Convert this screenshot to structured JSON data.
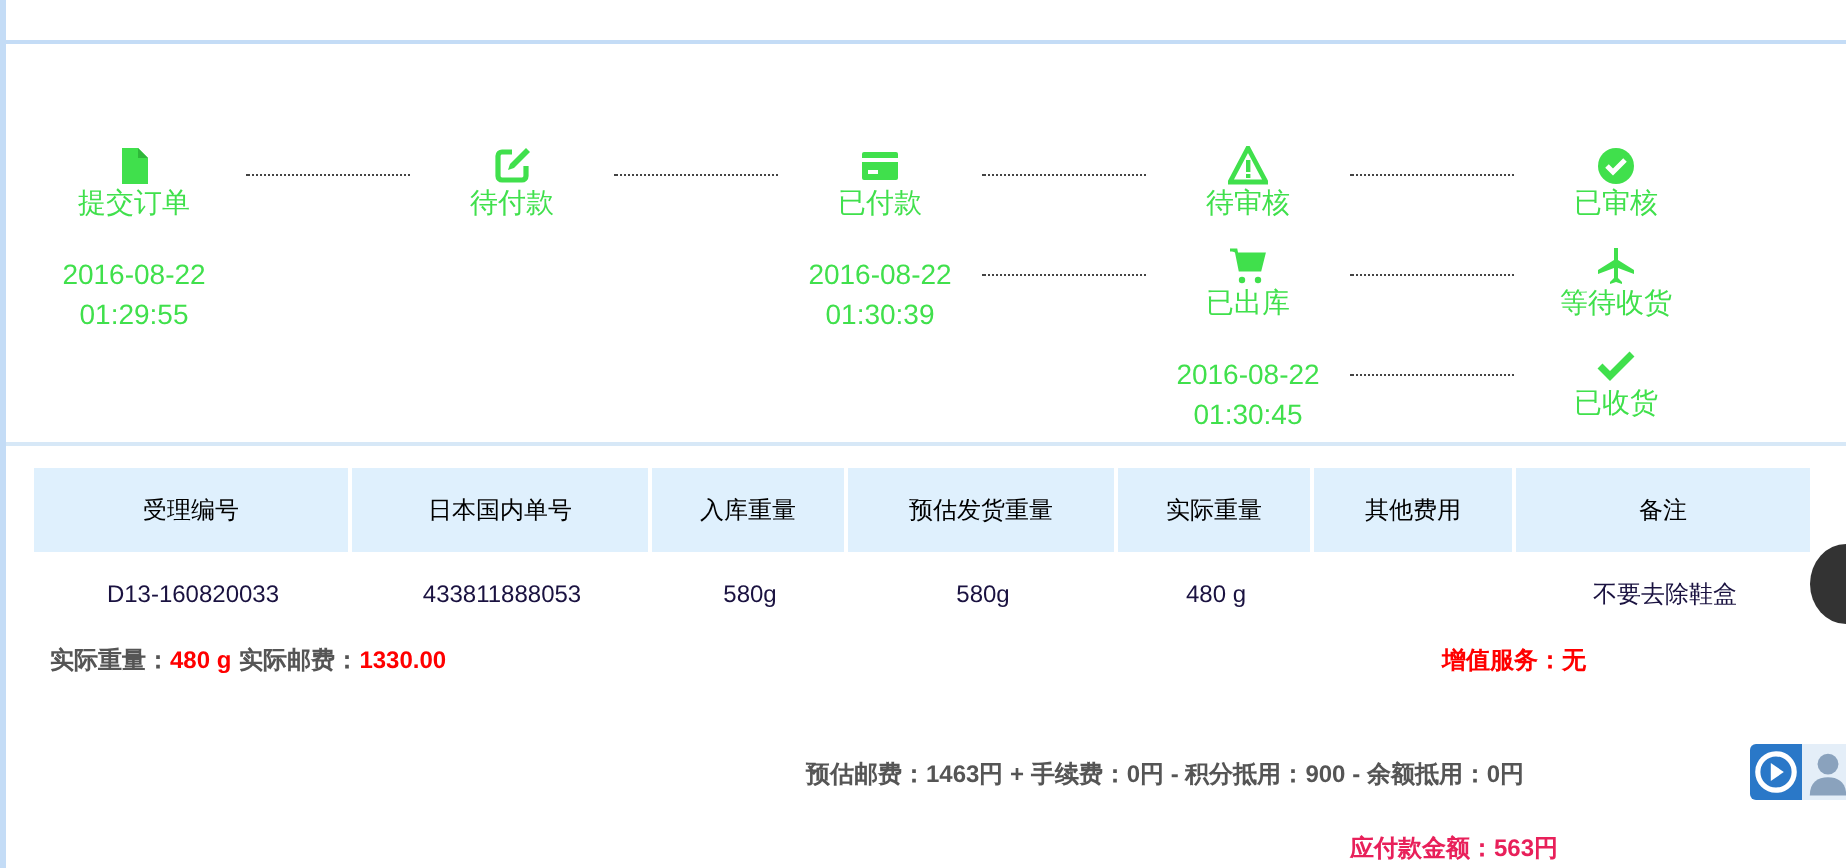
{
  "progress": {
    "rows": [
      [
        {
          "kind": "step",
          "label": "提交订单"
        },
        {
          "kind": "dots"
        },
        {
          "kind": "step",
          "label": "待付款"
        },
        {
          "kind": "dots"
        },
        {
          "kind": "step",
          "label": "已付款"
        },
        {
          "kind": "dots"
        },
        {
          "kind": "step",
          "label": "待审核"
        },
        {
          "kind": "dots"
        },
        {
          "kind": "step",
          "label": "已审核"
        }
      ],
      [
        {
          "kind": "time",
          "date": "2016-08-22",
          "time": "01:29:55"
        },
        {
          "kind": "empty"
        },
        {
          "kind": "empty"
        },
        {
          "kind": "empty"
        },
        {
          "kind": "time",
          "date": "2016-08-22",
          "time": "01:30:39"
        },
        {
          "kind": "dots"
        },
        {
          "kind": "step",
          "label": "已出库"
        },
        {
          "kind": "dots"
        },
        {
          "kind": "step",
          "label": "等待收货"
        }
      ],
      [
        {
          "kind": "empty"
        },
        {
          "kind": "empty"
        },
        {
          "kind": "empty"
        },
        {
          "kind": "empty"
        },
        {
          "kind": "empty"
        },
        {
          "kind": "empty"
        },
        {
          "kind": "time",
          "date": "2016-08-22",
          "time": "01:30:45"
        },
        {
          "kind": "dots"
        },
        {
          "kind": "step",
          "label": "已收货"
        }
      ]
    ]
  },
  "table": {
    "columns": [
      "受理编号",
      "日本国内单号",
      "入库重量",
      "预估发货重量",
      "实际重量",
      "其他费用",
      "备注"
    ],
    "rows": [
      [
        "D13-160820033",
        "433811888053",
        "580g",
        "580g",
        "480 g",
        "",
        "不要去除鞋盒"
      ]
    ]
  },
  "summary": {
    "weight_label": "实际重量：",
    "weight": "480 g",
    "postage_label": "实际邮费：",
    "postage": "1330.00",
    "service_label": "增值服务：",
    "service": "无"
  },
  "fees": {
    "text": "预估邮费：1463円 + 手续费：0円 - 积分抵用：900 - 余额抵用：0円"
  },
  "total": {
    "label": "应付款金额：",
    "value": "563円"
  }
}
